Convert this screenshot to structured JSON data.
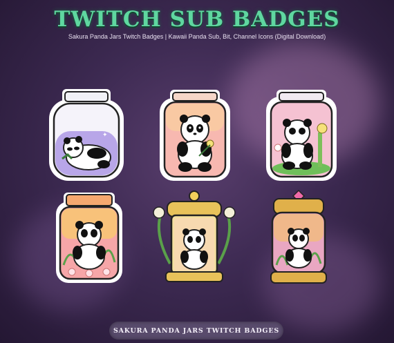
{
  "header": {
    "title": "TWITCH SUB BADGES",
    "subtitle": "Sakura Panda Jars Twitch Badges | Kawaii Panda Sub, Bit, Channel Icons (Digital Download)"
  },
  "badges": [
    {
      "label": "",
      "icon": "sleeping-panda-jar-icon",
      "jar_color": "#b8a6e8"
    },
    {
      "label": "",
      "icon": "panda-flower-jar-icon",
      "jar_color": "#f7b8b0"
    },
    {
      "label": "",
      "icon": "panda-bamboo-jar-icon",
      "jar_color": "#f5c2d2"
    },
    {
      "label": "",
      "icon": "sunset-panda-jar-icon",
      "jar_color": "#f6a6a8"
    },
    {
      "label": "",
      "icon": "golden-lantern-panda-icon",
      "jar_color": "#e8c25a"
    },
    {
      "label": "",
      "icon": "gem-jar-panda-icon",
      "jar_color": "#e9a7c2"
    }
  ],
  "footer": {
    "label": "SAKURA PANDA JARS TWITCH BADGES"
  },
  "colors": {
    "title": "#5fd7a0",
    "background": "#3d2a52"
  }
}
